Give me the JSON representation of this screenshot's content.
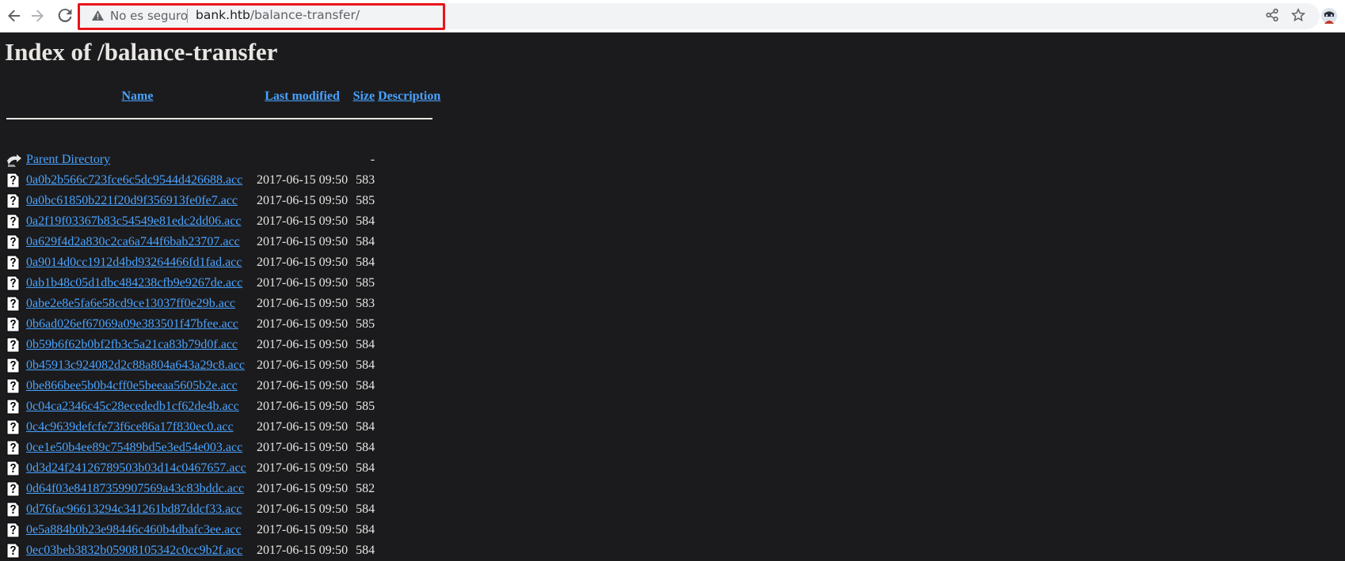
{
  "browser": {
    "security_label": "No es seguro",
    "url_host": "bank.htb",
    "url_path": "/balance-transfer/",
    "highlight_color": "#e8141a"
  },
  "page": {
    "title": "Index of /balance-transfer",
    "columns": {
      "name": "Name",
      "last_modified": "Last modified",
      "size": "Size",
      "description": "Description"
    },
    "parent": {
      "name": "Parent Directory",
      "size": "-"
    },
    "files": [
      {
        "name": "0a0b2b566c723fce6c5dc9544d426688.acc",
        "modified": "2017-06-15 09:50",
        "size": "583"
      },
      {
        "name": "0a0bc61850b221f20d9f356913fe0fe7.acc",
        "modified": "2017-06-15 09:50",
        "size": "585"
      },
      {
        "name": "0a2f19f03367b83c54549e81edc2dd06.acc",
        "modified": "2017-06-15 09:50",
        "size": "584"
      },
      {
        "name": "0a629f4d2a830c2ca6a744f6bab23707.acc",
        "modified": "2017-06-15 09:50",
        "size": "584"
      },
      {
        "name": "0a9014d0cc1912d4bd93264466fd1fad.acc",
        "modified": "2017-06-15 09:50",
        "size": "584"
      },
      {
        "name": "0ab1b48c05d1dbc484238cfb9e9267de.acc",
        "modified": "2017-06-15 09:50",
        "size": "585"
      },
      {
        "name": "0abe2e8e5fa6e58cd9ce13037ff0e29b.acc",
        "modified": "2017-06-15 09:50",
        "size": "583"
      },
      {
        "name": "0b6ad026ef67069a09e383501f47bfee.acc",
        "modified": "2017-06-15 09:50",
        "size": "585"
      },
      {
        "name": "0b59b6f62b0bf2fb3c5a21ca83b79d0f.acc",
        "modified": "2017-06-15 09:50",
        "size": "584"
      },
      {
        "name": "0b45913c924082d2c88a804a643a29c8.acc",
        "modified": "2017-06-15 09:50",
        "size": "584"
      },
      {
        "name": "0be866bee5b0b4cff0e5beeaa5605b2e.acc",
        "modified": "2017-06-15 09:50",
        "size": "584"
      },
      {
        "name": "0c04ca2346c45c28ecededb1cf62de4b.acc",
        "modified": "2017-06-15 09:50",
        "size": "585"
      },
      {
        "name": "0c4c9639defcfe73f6ce86a17f830ec0.acc",
        "modified": "2017-06-15 09:50",
        "size": "584"
      },
      {
        "name": "0ce1e50b4ee89c75489bd5e3ed54e003.acc",
        "modified": "2017-06-15 09:50",
        "size": "584"
      },
      {
        "name": "0d3d24f24126789503b03d14c0467657.acc",
        "modified": "2017-06-15 09:50",
        "size": "584"
      },
      {
        "name": "0d64f03e84187359907569a43c83bddc.acc",
        "modified": "2017-06-15 09:50",
        "size": "582"
      },
      {
        "name": "0d76fac96613294c341261bd87ddcf33.acc",
        "modified": "2017-06-15 09:50",
        "size": "584"
      },
      {
        "name": "0e5a884b0b23e98446c460b4dbafc3ee.acc",
        "modified": "2017-06-15 09:50",
        "size": "584"
      },
      {
        "name": "0ec03beb3832b05908105342c0cc9b2f.acc",
        "modified": "2017-06-15 09:50",
        "size": "584"
      }
    ]
  },
  "icons": {
    "back": "arrow-left-icon",
    "forward": "arrow-right-icon",
    "reload": "reload-icon",
    "warning": "warning-triangle-icon",
    "share": "share-icon",
    "bookmark": "star-icon",
    "profile": "profile-avatar",
    "parent": "back-folder-icon",
    "file": "unknown-file-icon"
  }
}
